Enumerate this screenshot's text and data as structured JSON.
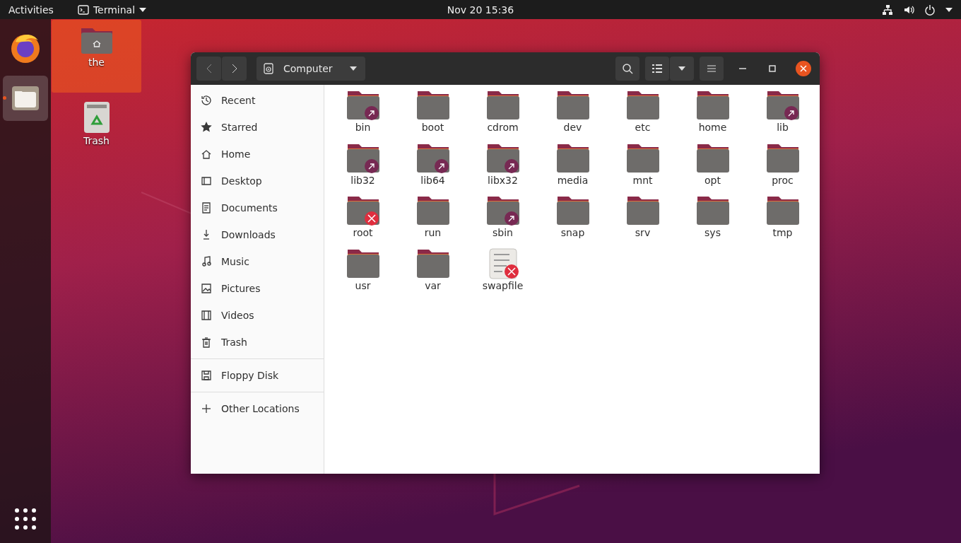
{
  "topbar": {
    "activities": "Activities",
    "app_menu": "Terminal",
    "clock": "Nov 20  15:36"
  },
  "dock": [
    {
      "kind": "firefox",
      "selected": false
    },
    {
      "kind": "files",
      "selected": true
    }
  ],
  "desktop_icons": [
    {
      "label": "the",
      "kind": "home-folder",
      "selected": true
    },
    {
      "label": "Trash",
      "kind": "trash",
      "selected": false
    }
  ],
  "window": {
    "location": "Computer",
    "sidebar": [
      [
        {
          "label": "Recent",
          "kind": "recent"
        },
        {
          "label": "Starred",
          "kind": "star"
        },
        {
          "label": "Home",
          "kind": "home"
        },
        {
          "label": "Desktop",
          "kind": "desktop"
        },
        {
          "label": "Documents",
          "kind": "document"
        },
        {
          "label": "Downloads",
          "kind": "download"
        },
        {
          "label": "Music",
          "kind": "music"
        },
        {
          "label": "Pictures",
          "kind": "picture"
        },
        {
          "label": "Videos",
          "kind": "video"
        },
        {
          "label": "Trash",
          "kind": "trash"
        }
      ],
      [
        {
          "label": "Floppy Disk",
          "kind": "disk"
        }
      ],
      [
        {
          "label": "Other Locations",
          "kind": "plus"
        }
      ]
    ],
    "files": [
      {
        "name": "bin",
        "kind": "link"
      },
      {
        "name": "boot",
        "kind": "folder"
      },
      {
        "name": "cdrom",
        "kind": "folder"
      },
      {
        "name": "dev",
        "kind": "folder"
      },
      {
        "name": "etc",
        "kind": "folder"
      },
      {
        "name": "home",
        "kind": "folder"
      },
      {
        "name": "lib",
        "kind": "link"
      },
      {
        "name": "lib32",
        "kind": "link"
      },
      {
        "name": "lib64",
        "kind": "link"
      },
      {
        "name": "libx32",
        "kind": "link"
      },
      {
        "name": "media",
        "kind": "folder"
      },
      {
        "name": "mnt",
        "kind": "folder"
      },
      {
        "name": "opt",
        "kind": "folder"
      },
      {
        "name": "proc",
        "kind": "folder"
      },
      {
        "name": "root",
        "kind": "locked"
      },
      {
        "name": "run",
        "kind": "folder"
      },
      {
        "name": "sbin",
        "kind": "link"
      },
      {
        "name": "snap",
        "kind": "folder"
      },
      {
        "name": "srv",
        "kind": "folder"
      },
      {
        "name": "sys",
        "kind": "folder"
      },
      {
        "name": "tmp",
        "kind": "folder"
      },
      {
        "name": "usr",
        "kind": "folder"
      },
      {
        "name": "var",
        "kind": "folder"
      },
      {
        "name": "swapfile",
        "kind": "binary"
      }
    ]
  }
}
